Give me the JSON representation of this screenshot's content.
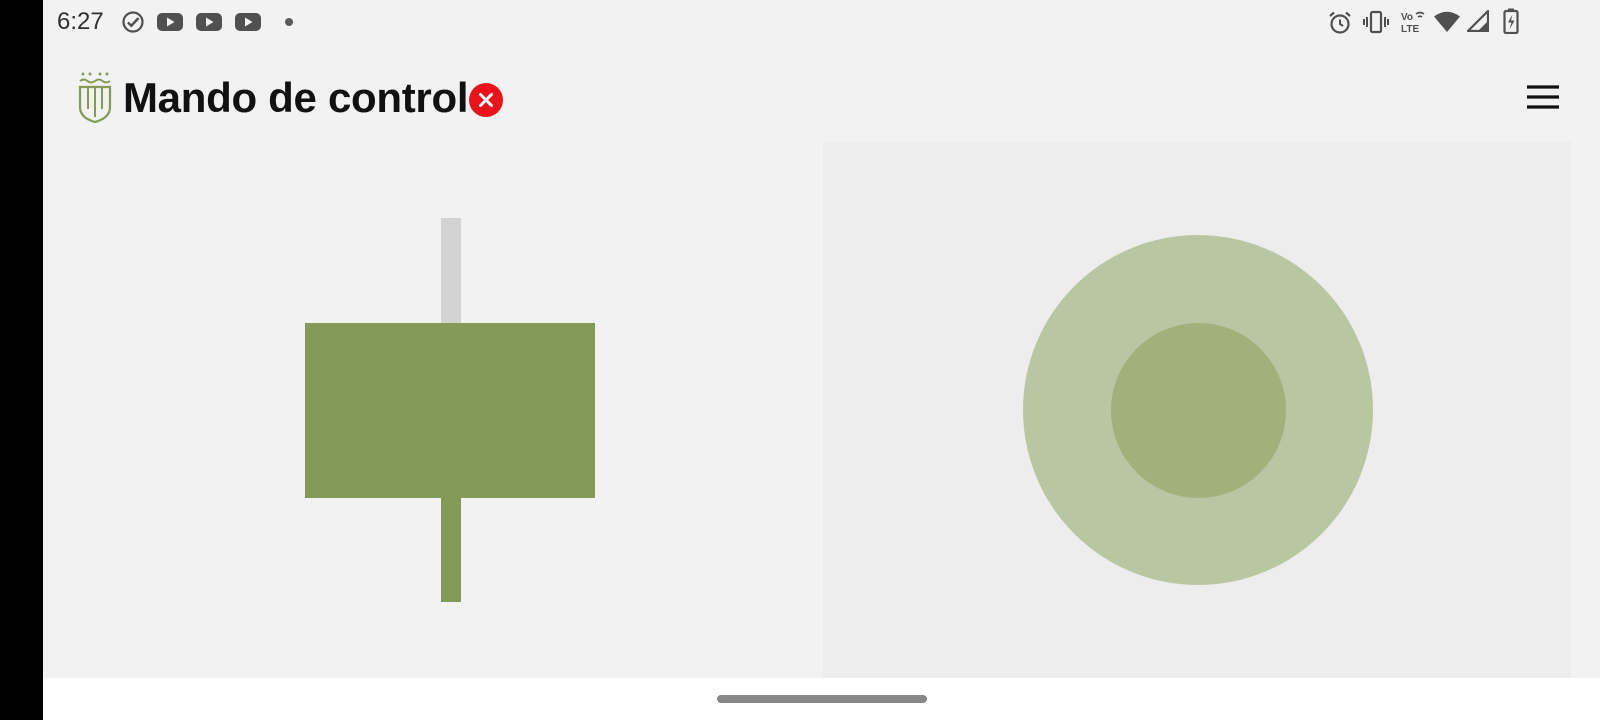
{
  "status_bar": {
    "time": "6:27",
    "left_icons": [
      "check-circle-icon",
      "youtube-icon",
      "youtube-icon",
      "youtube-icon",
      "notification-dot-icon"
    ],
    "right_icons": [
      "alarm-icon",
      "vibrate-icon",
      "volte-icon",
      "wifi-icon",
      "signal-icon",
      "battery-charging-icon"
    ],
    "volte_text": "Vo",
    "lte_text": "LTE"
  },
  "header": {
    "title": "Mando de control",
    "logo_icon": "crown-shield-logo",
    "status_badge_icon": "close-icon",
    "status_badge_color": "#e8141b",
    "menu_icon": "hamburger-menu-icon"
  },
  "controls": {
    "throttle_level": 0.5,
    "joystick_x": 0,
    "joystick_y": 0
  },
  "colors": {
    "accent": "#849b57",
    "joystick_base": "#b9c6a2",
    "joystick_knob": "#a0b17c",
    "track": "#d3d3d3",
    "background": "#f2f2f2"
  }
}
